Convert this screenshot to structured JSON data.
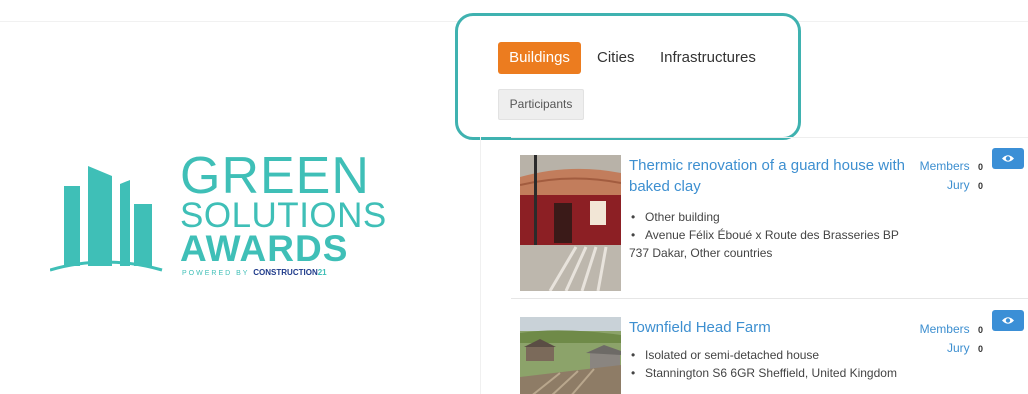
{
  "logo": {
    "line1": "GREEN",
    "line2": "SOLUTIONS",
    "line3": "AWARDS",
    "powered_prefix": "POWERED BY ",
    "powered_brand": "CONSTRUCTION21",
    "brand_color": "#3fbfb7"
  },
  "tabs": {
    "items": [
      {
        "label": "Buildings",
        "active": true
      },
      {
        "label": "Cities",
        "active": false
      },
      {
        "label": "Infrastructures",
        "active": false
      }
    ],
    "sub_filter": "Participants",
    "active_color": "#ec7c1f",
    "highlight_color": "#3fb2b0"
  },
  "projects": [
    {
      "title": "Thermic renovation of a guard house with baked clay",
      "bullets": [
        "Other building",
        "Avenue Félix Éboué x Route des Brasseries BP"
      ],
      "continuation": "737 Dakar, Other countries",
      "members_label": "Members",
      "members_count": "0",
      "jury_label": "Jury",
      "jury_count": "0",
      "view_icon": "eye-icon"
    },
    {
      "title": "Townfield Head Farm",
      "bullets": [
        "Isolated or semi-detached house",
        "Stannington S6 6GR Sheffield, United Kingdom"
      ],
      "members_label": "Members",
      "members_count": "0",
      "jury_label": "Jury",
      "jury_count": "0",
      "view_icon": "eye-icon"
    }
  ],
  "link_color": "#3d8fd0"
}
